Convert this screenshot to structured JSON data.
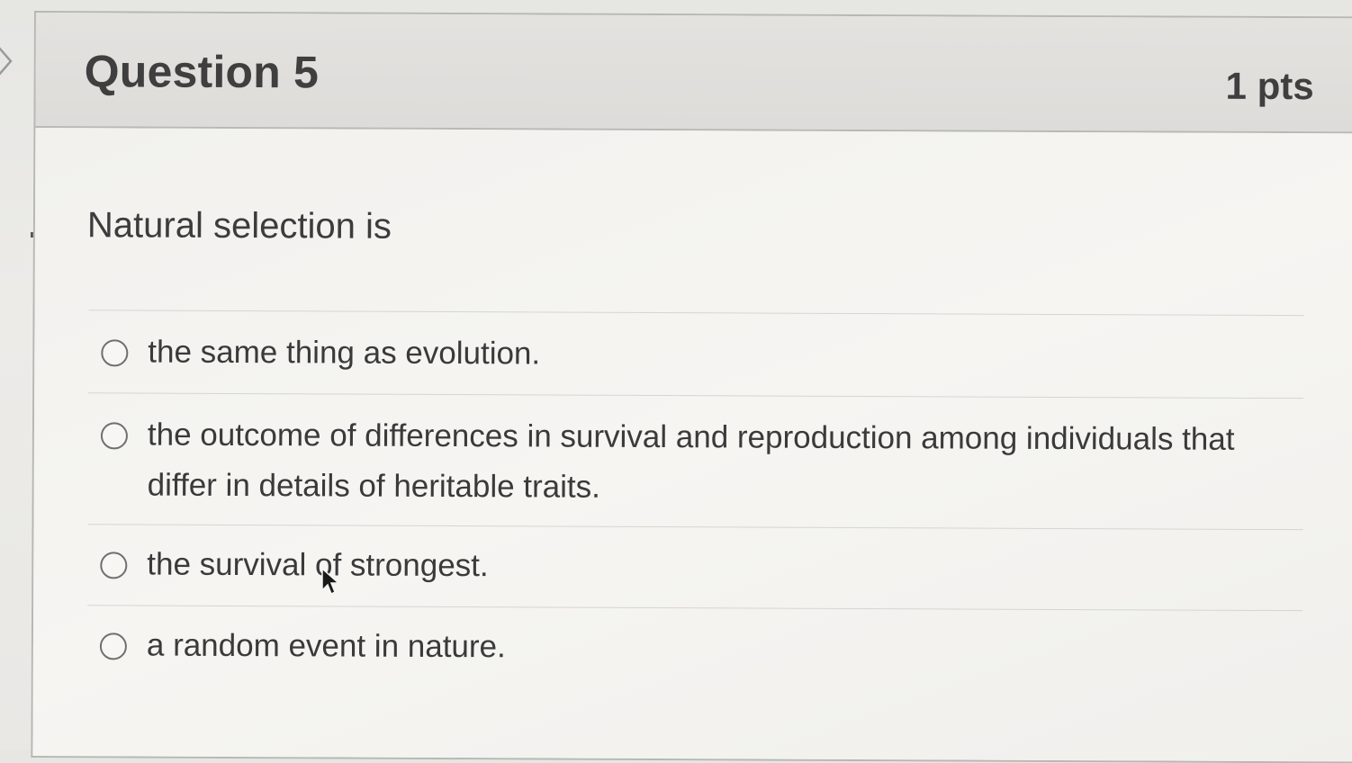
{
  "question": {
    "title": "Question 5",
    "points": "1 pts",
    "prompt": "Natural selection is"
  },
  "answers": [
    {
      "label": "the same thing as evolution.",
      "selected": false
    },
    {
      "label": "the outcome of differences in survival and reproduction among individuals that differ in details of heritable traits.",
      "selected": false
    },
    {
      "label": "the survival of strongest.",
      "selected": false
    },
    {
      "label": "a random event in nature.",
      "selected": false
    }
  ],
  "icons": {
    "radio": "radio-button-icon",
    "pointer": "mouse-pointer-icon",
    "nav": "chevron-right-icon"
  },
  "colors": {
    "header_bg": "#dedcd9",
    "body_bg": "#f2f1ee",
    "text": "#3c3c3c",
    "border": "#b7b7b4"
  }
}
